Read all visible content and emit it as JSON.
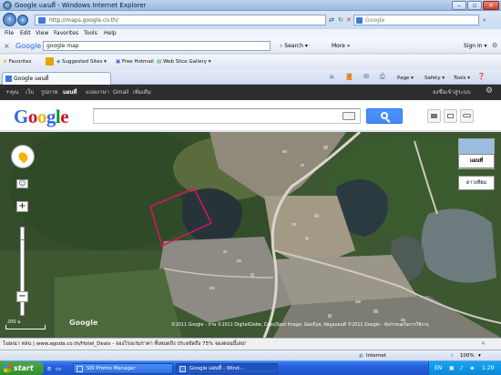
{
  "window": {
    "title": "Google แผนที่ - Windows Internet Explorer",
    "url": "http://maps.google.co.th/",
    "search_placeholder": "Google"
  },
  "menu": [
    "File",
    "Edit",
    "View",
    "Favorites",
    "Tools",
    "Help"
  ],
  "google_toolbar": {
    "brand": "Google",
    "query": "google map",
    "search_label": "Search",
    "more_label": "More",
    "sign_in": "Sign In"
  },
  "favorites_bar": {
    "favorites": "Favorites",
    "suggested": "Suggested Sites",
    "hotmail": "Free Hotmail",
    "gallery": "Web Slice Gallery"
  },
  "tab": {
    "title": "Google แผนที่",
    "commands": [
      "Page",
      "Safety",
      "Tools"
    ]
  },
  "gbar": {
    "items": [
      "+คุณ",
      "เว็บ",
      "รูปภาพ",
      "แผนที่",
      "แปลภาษา",
      "Gmail",
      "เพิ่มเติม"
    ],
    "active_index": 3,
    "sign_in": "ลงชื่อเข้าสู่ระบบ"
  },
  "header": {
    "logo": "Google"
  },
  "map": {
    "brand": "Google",
    "scale": "200 ม.",
    "map_button": "แผนที่",
    "satellite_button": "ดาวเทียม",
    "copyright": "©2011 Google - ภาพ ©2011 DigitalGlobe, Cnes/Spot Image, GeoEye, ข้อมูลแผนที่ ©2011 Google - ข้อกำหนดในการใช้งาน"
  },
  "status": {
    "ad": "โฆษณา หลน | www.agoda.co.th/Hotel_Deals - จองโรงแรมราคา ทั้งหมดถึง ประหยัดถึง 75% จองตอนนี้เลย!",
    "zone": "Internet",
    "zoom": "100%"
  },
  "taskbar": {
    "start": "start",
    "items": [
      "SIS Promo Manager",
      "Google แผนที่ - Wind..."
    ],
    "clock": "1:29"
  },
  "colors": {
    "accent": "#4d90fe",
    "polygon": "#e0115f",
    "taskbar": "#245edb"
  }
}
